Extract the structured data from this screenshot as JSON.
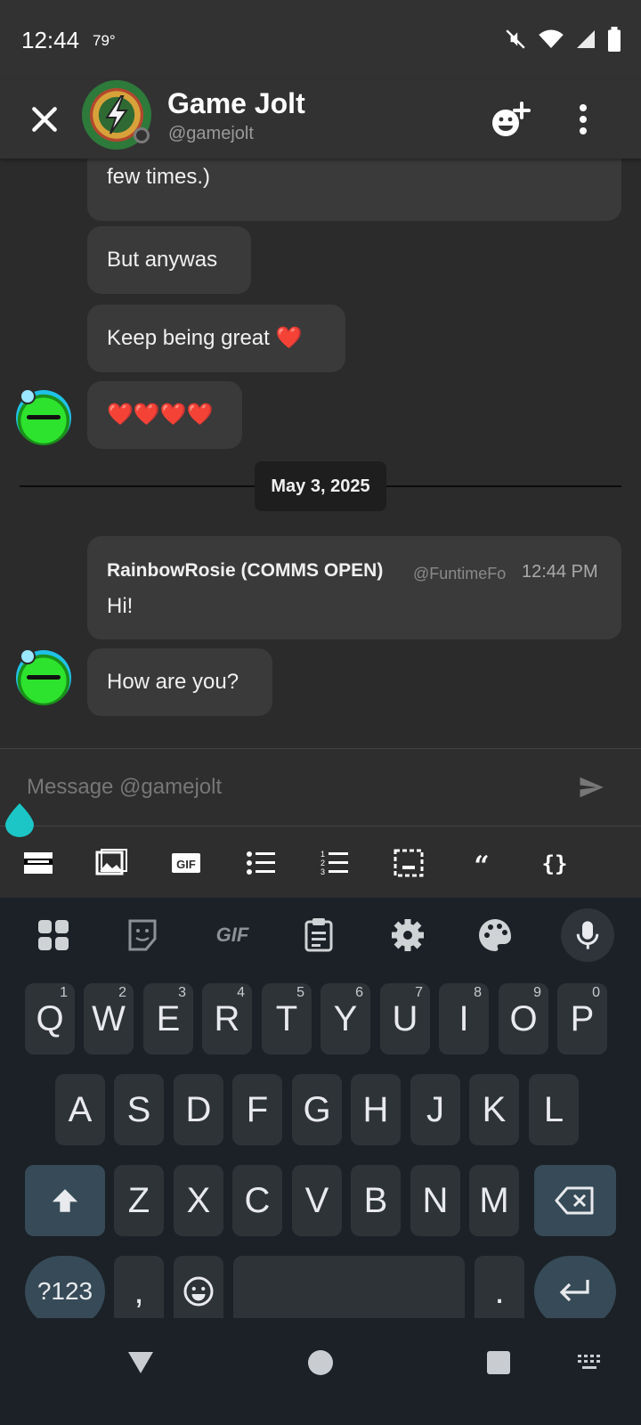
{
  "status_bar": {
    "time": "12:44",
    "temperature": "79°",
    "icons": [
      "mute-icon",
      "wifi-icon",
      "signal-icon",
      "battery-icon"
    ]
  },
  "header": {
    "title": "Game Jolt",
    "handle": "@gamejolt",
    "icons": [
      "close-icon",
      "add-friend-icon",
      "more-vert-icon"
    ]
  },
  "messages": [
    {
      "text": "Frucking love you (not like I thought about quitting a few times.)"
    },
    {
      "text": "But anywas"
    },
    {
      "text": "Keep being great ❤️"
    },
    {
      "text": "❤️❤️❤️❤️"
    }
  ],
  "date_divider": "May 3, 2025",
  "new_messages": {
    "author": "RainbowRosie (COMMS OPEN)",
    "handle": "@FuntimeFo",
    "time": "12:44 PM",
    "items": [
      {
        "text": "Hi!"
      },
      {
        "text": "How are you?"
      }
    ]
  },
  "composer": {
    "placeholder": "Message @gamejolt"
  },
  "format_bar": {
    "tools": [
      "spoiler-icon",
      "image-icon",
      "gif-icon",
      "bullet-list-icon",
      "numbered-list-icon",
      "embed-icon",
      "quote-icon",
      "code-icon"
    ]
  },
  "keyboard": {
    "toolbar": [
      "apps-icon",
      "sticker-icon",
      "gif-icon",
      "clipboard-icon",
      "settings-icon",
      "palette-icon",
      "mic-icon"
    ],
    "gif_label": "GIF",
    "row1": [
      {
        "key": "Q",
        "num": "1"
      },
      {
        "key": "W",
        "num": "2"
      },
      {
        "key": "E",
        "num": "3"
      },
      {
        "key": "R",
        "num": "4"
      },
      {
        "key": "T",
        "num": "5"
      },
      {
        "key": "Y",
        "num": "6"
      },
      {
        "key": "U",
        "num": "7"
      },
      {
        "key": "I",
        "num": "8"
      },
      {
        "key": "O",
        "num": "9"
      },
      {
        "key": "P",
        "num": "0"
      }
    ],
    "row2": [
      "A",
      "S",
      "D",
      "F",
      "G",
      "H",
      "J",
      "K",
      "L"
    ],
    "row3": [
      "Z",
      "X",
      "C",
      "V",
      "B",
      "N",
      "M"
    ],
    "row4": {
      "symbols": "?123",
      "comma": ",",
      "period": "."
    }
  },
  "colors": {
    "background": "#2b2b2b",
    "bubble": "#3a3a3a",
    "accent_teal": "#1cc6c6",
    "keyboard_bg": "#1b2126",
    "key_bg": "#2e3338",
    "key_special": "#364a57"
  }
}
